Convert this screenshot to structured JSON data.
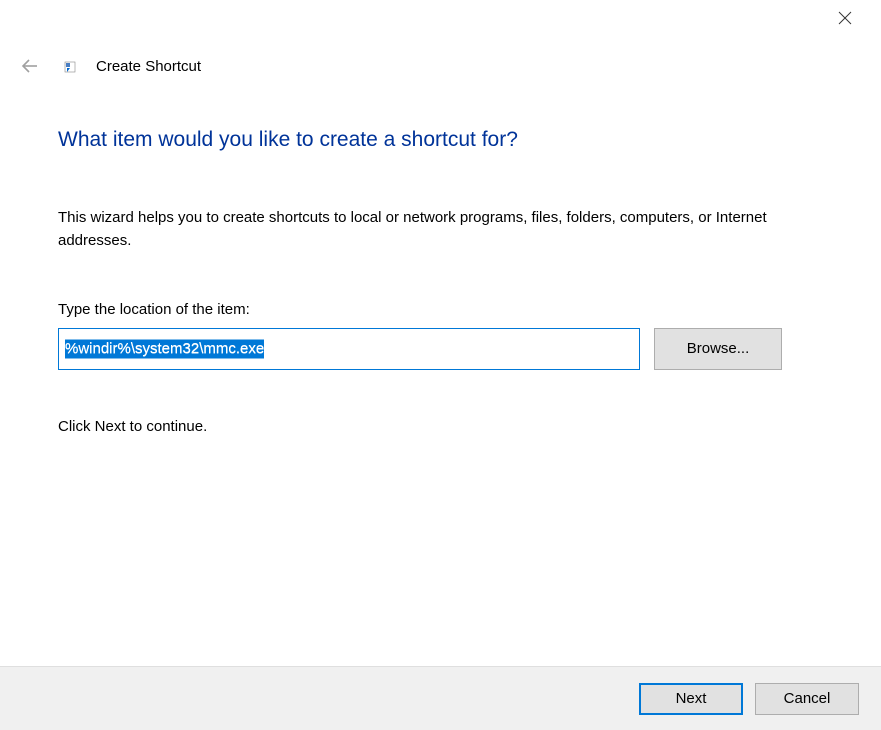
{
  "window": {
    "title": "Create Shortcut"
  },
  "content": {
    "heading": "What item would you like to create a shortcut for?",
    "description": "This wizard helps you to create shortcuts to local or network programs, files, folders, computers, or Internet addresses.",
    "field_label": "Type the location of the item:",
    "location_value": "%windir%\\system32\\mmc.exe",
    "browse_label": "Browse...",
    "continue_text": "Click Next to continue."
  },
  "footer": {
    "next_label": "Next",
    "cancel_label": "Cancel"
  }
}
